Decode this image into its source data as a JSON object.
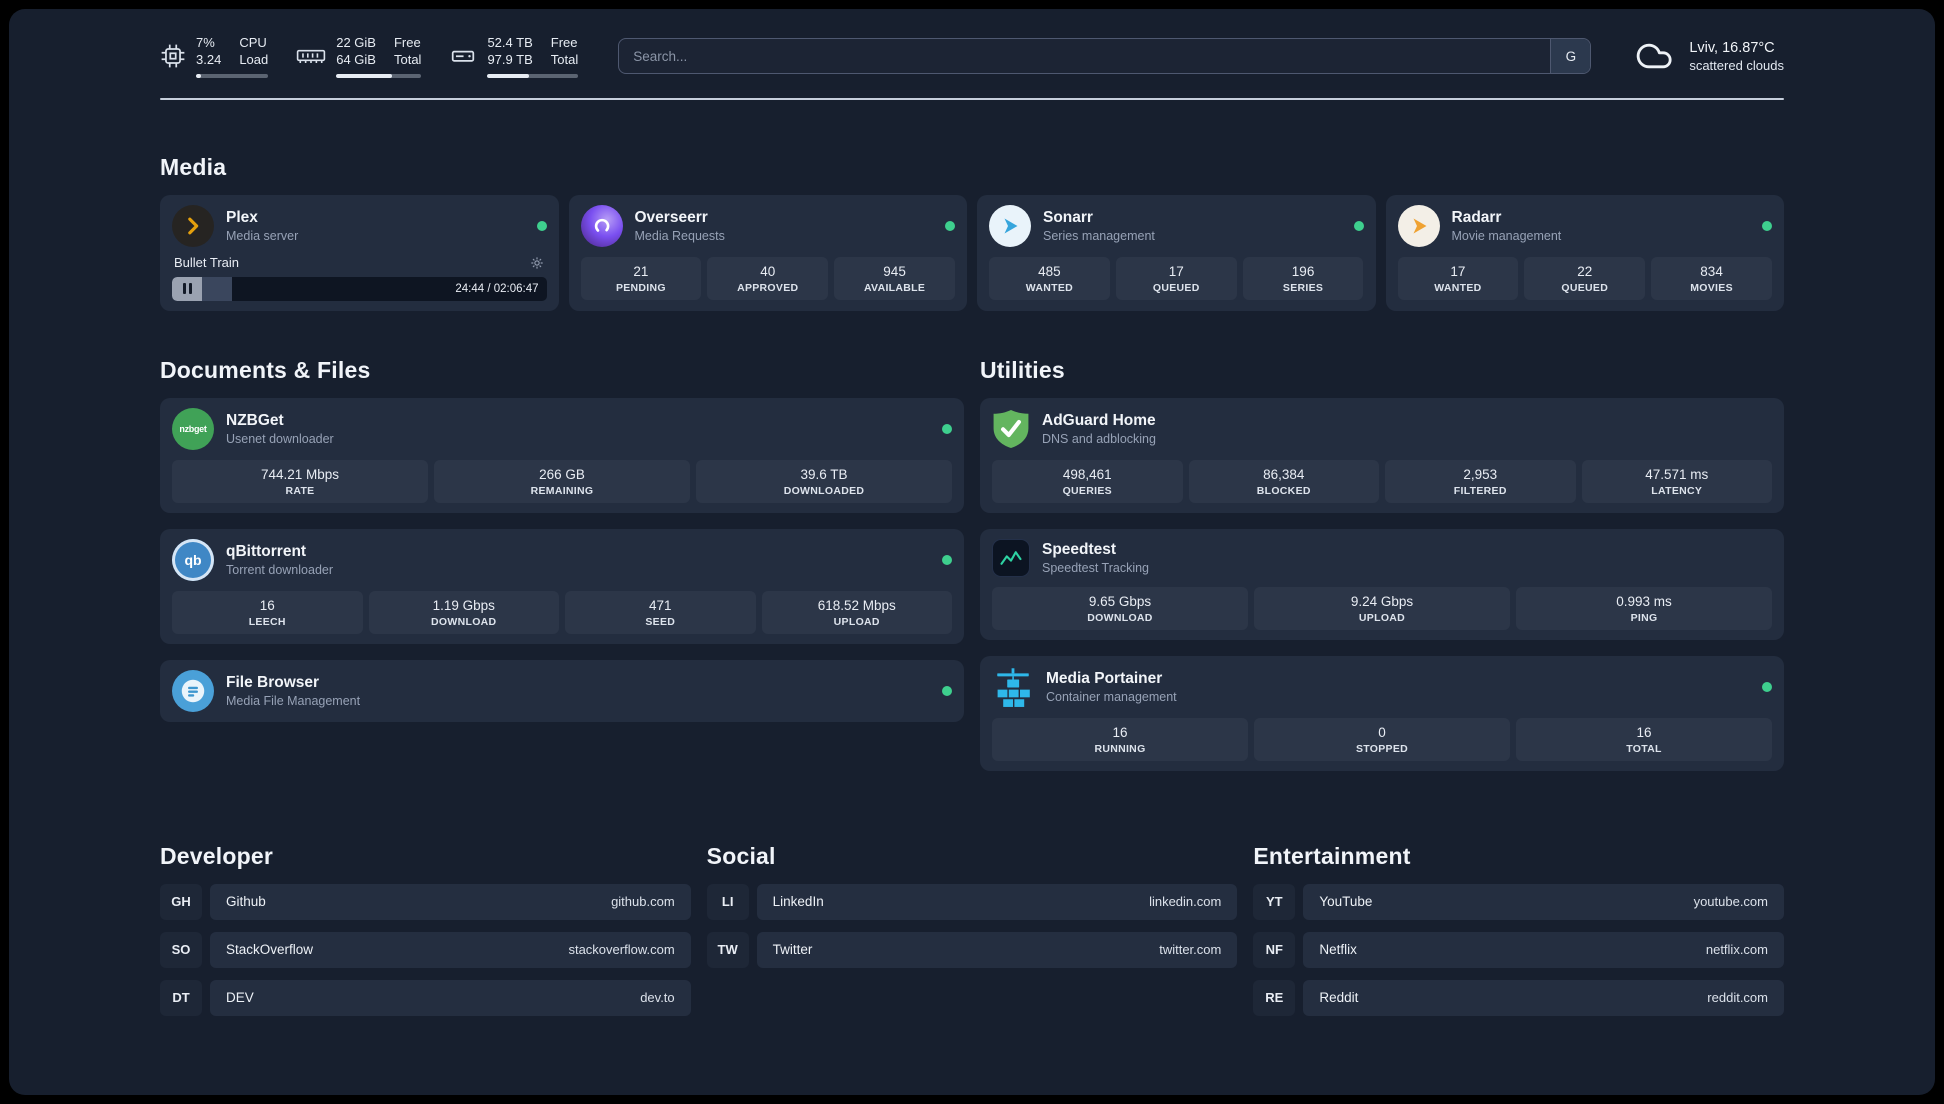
{
  "topbar": {
    "cpu": {
      "value_top": "7%",
      "value_bottom": "3.24",
      "label_top": "CPU",
      "label_bottom": "Load",
      "percent": 7
    },
    "ram": {
      "value_top": "22 GiB",
      "value_bottom": "64 GiB",
      "label_top": "Free",
      "label_bottom": "Total",
      "percent": 66
    },
    "disk": {
      "value_top": "52.4 TB",
      "value_bottom": "97.9 TB",
      "label_top": "Free",
      "label_bottom": "Total",
      "percent": 46
    },
    "search": {
      "placeholder": "Search...",
      "engine_button": "G"
    },
    "weather": {
      "location": "Lviv, 16.87°C",
      "condition": "scattered clouds"
    }
  },
  "sections": {
    "media": "Media",
    "documents": "Documents & Files",
    "utilities": "Utilities",
    "developer": "Developer",
    "social": "Social",
    "entertainment": "Entertainment"
  },
  "cards": {
    "plex": {
      "name": "Plex",
      "subtitle": "Media server",
      "player": {
        "title": "Bullet Train",
        "time": "24:44 / 02:06:47",
        "progress_percent": 16
      }
    },
    "overseerr": {
      "name": "Overseerr",
      "subtitle": "Media Requests",
      "stats": [
        {
          "value": "21",
          "label": "PENDING"
        },
        {
          "value": "40",
          "label": "APPROVED"
        },
        {
          "value": "945",
          "label": "AVAILABLE"
        }
      ]
    },
    "sonarr": {
      "name": "Sonarr",
      "subtitle": "Series management",
      "stats": [
        {
          "value": "485",
          "label": "WANTED"
        },
        {
          "value": "17",
          "label": "QUEUED"
        },
        {
          "value": "196",
          "label": "SERIES"
        }
      ]
    },
    "radarr": {
      "name": "Radarr",
      "subtitle": "Movie management",
      "stats": [
        {
          "value": "17",
          "label": "WANTED"
        },
        {
          "value": "22",
          "label": "QUEUED"
        },
        {
          "value": "834",
          "label": "MOVIES"
        }
      ]
    },
    "nzbget": {
      "name": "NZBGet",
      "subtitle": "Usenet downloader",
      "icon_text": "nzbget",
      "stats": [
        {
          "value": "744.21 Mbps",
          "label": "RATE"
        },
        {
          "value": "266 GB",
          "label": "REMAINING"
        },
        {
          "value": "39.6 TB",
          "label": "DOWNLOADED"
        }
      ]
    },
    "qbittorrent": {
      "name": "qBittorrent",
      "subtitle": "Torrent downloader",
      "icon_text": "qb",
      "stats": [
        {
          "value": "16",
          "label": "LEECH"
        },
        {
          "value": "1.19 Gbps",
          "label": "DOWNLOAD"
        },
        {
          "value": "471",
          "label": "SEED"
        },
        {
          "value": "618.52 Mbps",
          "label": "UPLOAD"
        }
      ]
    },
    "filebrowser": {
      "name": "File Browser",
      "subtitle": "Media File Management"
    },
    "adguard": {
      "name": "AdGuard Home",
      "subtitle": "DNS and adblocking",
      "stats": [
        {
          "value": "498,461",
          "label": "QUERIES"
        },
        {
          "value": "86,384",
          "label": "BLOCKED"
        },
        {
          "value": "2,953",
          "label": "FILTERED"
        },
        {
          "value": "47.571 ms",
          "label": "LATENCY"
        }
      ]
    },
    "speedtest": {
      "name": "Speedtest",
      "subtitle": "Speedtest Tracking",
      "stats": [
        {
          "value": "9.65 Gbps",
          "label": "DOWNLOAD"
        },
        {
          "value": "9.24 Gbps",
          "label": "UPLOAD"
        },
        {
          "value": "0.993 ms",
          "label": "PING"
        }
      ]
    },
    "portainer": {
      "name": "Media Portainer",
      "subtitle": "Container management",
      "stats": [
        {
          "value": "16",
          "label": "RUNNING"
        },
        {
          "value": "0",
          "label": "STOPPED"
        },
        {
          "value": "16",
          "label": "TOTAL"
        }
      ]
    }
  },
  "bookmarks": {
    "developer": [
      {
        "abbr": "GH",
        "name": "Github",
        "url": "github.com"
      },
      {
        "abbr": "SO",
        "name": "StackOverflow",
        "url": "stackoverflow.com"
      },
      {
        "abbr": "DT",
        "name": "DEV",
        "url": "dev.to"
      }
    ],
    "social": [
      {
        "abbr": "LI",
        "name": "LinkedIn",
        "url": "linkedin.com"
      },
      {
        "abbr": "TW",
        "name": "Twitter",
        "url": "twitter.com"
      }
    ],
    "entertainment": [
      {
        "abbr": "YT",
        "name": "YouTube",
        "url": "youtube.com"
      },
      {
        "abbr": "NF",
        "name": "Netflix",
        "url": "netflix.com"
      },
      {
        "abbr": "RE",
        "name": "Reddit",
        "url": "reddit.com"
      }
    ]
  },
  "colors": {
    "status_online": "#3ecf8e",
    "accent": "#2fb8ec"
  }
}
